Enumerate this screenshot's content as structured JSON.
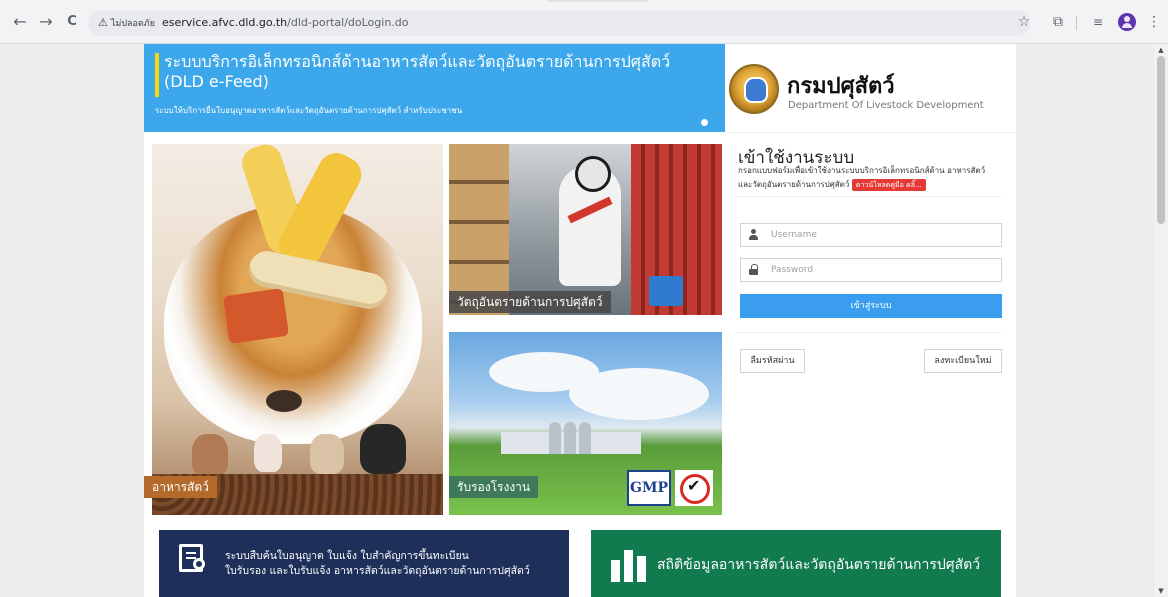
{
  "browser": {
    "back": "←",
    "forward": "→",
    "reload": "C",
    "security_label": "ไม่ปลอดภัย",
    "url_host": "eservice.afvc.dld.go.th",
    "url_path": "/dld-portal/doLogin.do",
    "icons": [
      "star-icon",
      "extensions-icon",
      "tab-search-icon",
      "profile-icon",
      "menu-icon"
    ]
  },
  "header": {
    "title_th": "ระบบบริการอิเล็กทรอนิกส์ด้านอาหารสัตว์และวัตถุอันตรายด้านการปศุสัตว์",
    "title_en": "(DLD e-Feed)",
    "subtitle": "ระบบให้บริการยื่นใบอนุญาตอาหารสัตว์และวัตถุอันตรายด้านการปศุสัตว์ สำหรับประชาชน",
    "accent_color": "#3ca7ea"
  },
  "logo": {
    "name_th": "กรมปศุสัตว์",
    "name_en": "Department Of Livestock Development"
  },
  "tiles": {
    "feed_label": "อาหารสัตว์",
    "hazard_label": "วัตถุอันตรายด้านการปศุสัตว์",
    "factory_label": "รับรองโรงงาน",
    "gmp_text": "GMP"
  },
  "login": {
    "title": "เข้าใช้งานระบบ",
    "description": "กรอกแบบฟอร์มเพื่อเข้าใช้งานระบบบริการอิเล็กทรอนิกส์ด้าน อาหารสัตว์และวัตถุอันตรายด้านการปศุสัตว์",
    "manual_badge": "ดาวน์โหลดคู่มือ คลิ๊...",
    "username_placeholder": "Username",
    "password_placeholder": "Password",
    "submit_label": "เข้าสู่ระบบ",
    "forgot_label": "ลืมรหัสผ่าน",
    "register_label": "ลงทะเบียนใหม่",
    "button_color": "#3b9df0"
  },
  "bottom": {
    "search_line1": "ระบบสืบค้นใบอนุญาต ใบแจ้ง ใบสำคัญการขึ้นทะเบียน",
    "search_line2": "ใบรับรอง และใบรับแจ้ง อาหารสัตว์และวัตถุอันตรายด้านการปศุสัตว์",
    "stats_label": "สถิติข้อมูลอาหารสัตว์และวัตถุอันตรายด้านการปศุสัตว์",
    "search_color": "#1e2f5a",
    "stats_color": "#117a4f"
  }
}
